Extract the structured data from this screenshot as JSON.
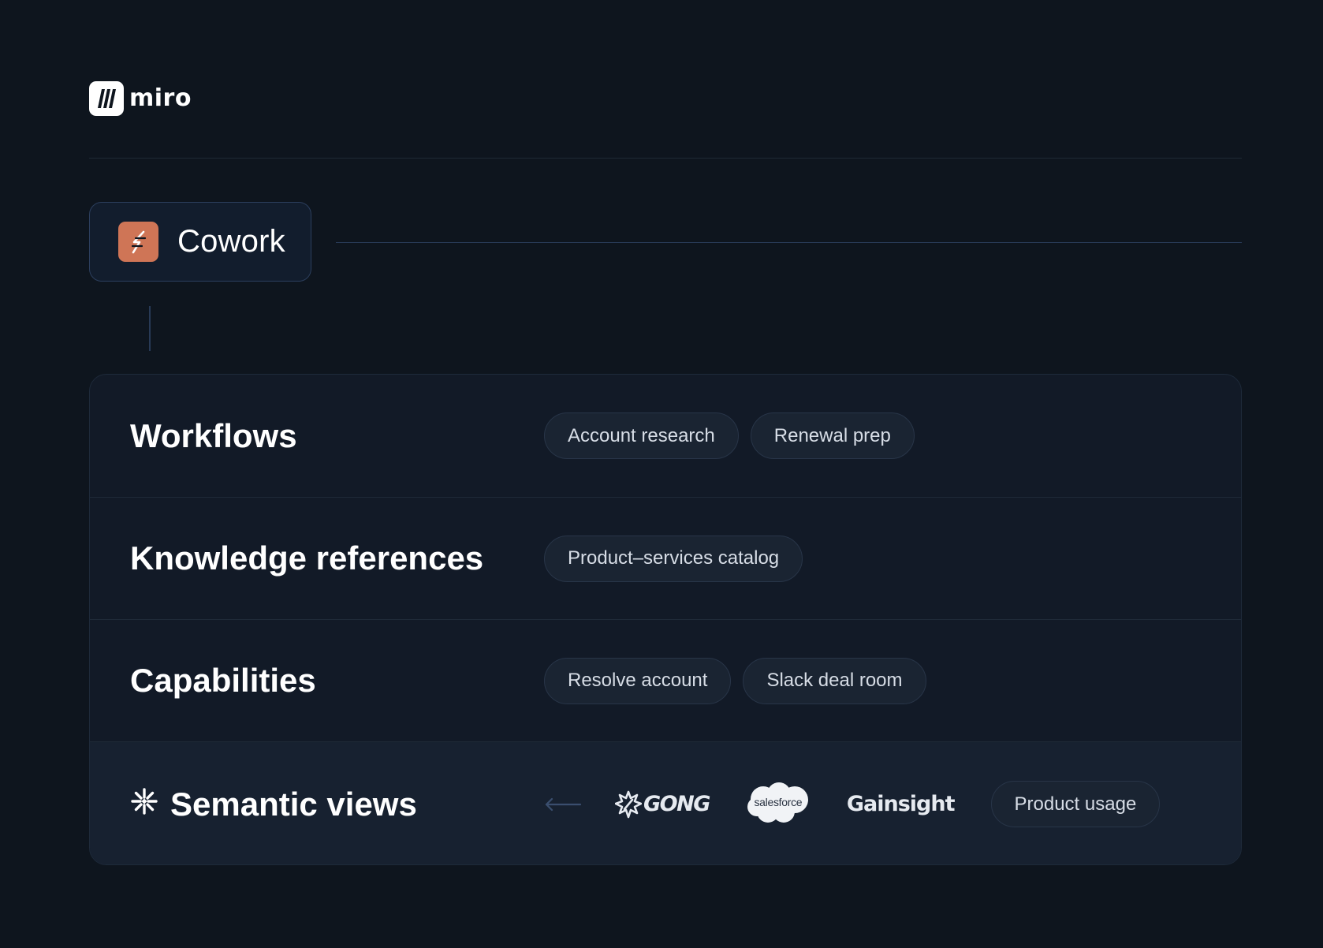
{
  "brand": {
    "name": "miro",
    "icon": "miro-logo-icon"
  },
  "root": {
    "label": "Cowork",
    "icon": "lightning-bolt-icon",
    "icon_color": "#cf7556"
  },
  "sections": [
    {
      "title": "Workflows",
      "chips": [
        "Account research",
        "Renewal prep"
      ]
    },
    {
      "title": "Knowledge references",
      "chips": [
        "Product–services catalog"
      ]
    },
    {
      "title": "Capabilities",
      "chips": [
        "Resolve account",
        "Slack deal room"
      ]
    }
  ],
  "semantic": {
    "title": "Semantic views",
    "icon": "snowflake-icon",
    "arrow_icon": "arrow-left-icon",
    "logos": {
      "gong": "GONG",
      "salesforce": "salesforce",
      "gainsight": "Gainsight"
    },
    "chip": "Product usage"
  },
  "colors": {
    "background": "#0e151e",
    "panel": "#121a27",
    "chip": "#1a2432",
    "accent": "#cf7556",
    "connector": "#283a56"
  }
}
